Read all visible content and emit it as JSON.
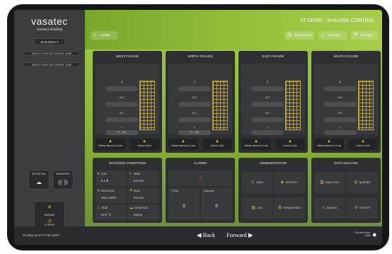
{
  "app": {
    "logo": "vasatec",
    "logo_sub": "connect shading",
    "title": "VT DEMO - SHADING CONTROL"
  },
  "sidebar": {
    "building_select": "BUILDING 1",
    "selectors": [
      "SELECT LEVEL OR CONTROL ZONE",
      "SELECT LEVEL OR CONTROL ZONE"
    ],
    "rotation": "ROTATION",
    "sensors": "SENSORS",
    "user_status": {
      "label": "DESIGN",
      "value": "17:09:00"
    }
  },
  "nav": {
    "home": "HOME",
    "schedule": "SCHEDULE",
    "alarm": "ALARM",
    "notes": "NOTES"
  },
  "facades": [
    {
      "title": "WEST FACADE",
      "levels": [
        "H",
        "M 2",
        "M 1",
        "L"
      ],
      "value": "R - L08",
      "btn_left": "Safety Hammer & Lock",
      "btn_right": "Unlock / Auto"
    },
    {
      "title": "NORTH FACADE",
      "levels": [
        "H",
        "M 2",
        "M 1",
        "L"
      ],
      "value": "R - L08",
      "btn_left": "Safety Hammer & Lock",
      "btn_right": "Unlock / Auto"
    },
    {
      "title": "EAST FACADE",
      "levels": [
        "H",
        "M 2",
        "M 1",
        "L"
      ],
      "value": "",
      "btn_left": "Safety Hammer & Lock",
      "btn_right": "Unlock / Auto"
    },
    {
      "title": "SOUTH FACADE",
      "levels": [
        "H",
        "M 2",
        "M 1",
        "L"
      ],
      "value": "",
      "btn_left": "Safety Hammer & Lock",
      "btn_right": "Unlock / Auto"
    }
  ],
  "outdoor": {
    "title": "OUTDOOR CONDITIONS",
    "cells": [
      {
        "label": "SUN",
        "value": "5.1 lb"
      },
      {
        "label": "WIND",
        "value": "0.0 m/s"
      },
      {
        "label": "RADIATION",
        "value": "401.1 W/m²"
      },
      {
        "label": "RAIN",
        "value": "0.0 mm"
      },
      {
        "label": "TEMP",
        "value": "24.0 °C"
      },
      {
        "label": "CONDITION",
        "value": "Sunny"
      }
    ]
  },
  "alarms": {
    "title": "ALARMS",
    "total_label": "TOTAL",
    "total": "0",
    "unsolved_label": "Unsolved",
    "unsolved": "0"
  },
  "administration": {
    "title": "ADMINISTRATION",
    "items": [
      "USER",
      "SECURITY",
      "LOG",
      "PARAMETERS"
    ]
  },
  "data_analysis": {
    "title": "DATA ANALYSIS",
    "items": [
      "ANALYTICS",
      "QUERIES",
      "SEARCH",
      "HISTORY"
    ]
  },
  "footer": {
    "date": "20-May-24 8:17 PM AEST",
    "back": "Back",
    "forward": "Forward",
    "current_user_label": "Current User:",
    "current_user": "rootk"
  },
  "colors": {
    "accent": "#8ab736",
    "panel": "#2d2f31",
    "icon": "#e8c53a"
  }
}
